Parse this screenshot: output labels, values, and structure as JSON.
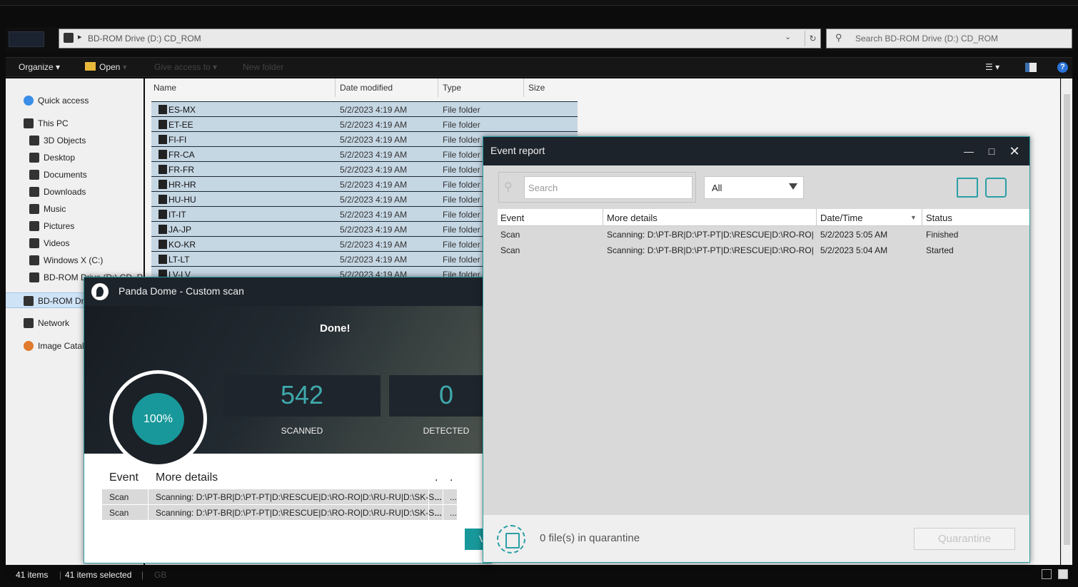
{
  "explorer": {
    "address": "BD-ROM Drive (D:) CD_ROM",
    "search_placeholder": "Search BD-ROM Drive (D:) CD_ROM",
    "toolbar": {
      "organize": "Organize",
      "open": "Open",
      "give_access": "Give access to",
      "new_folder": "New folder"
    },
    "nav": [
      {
        "label": "Quick access",
        "icon": "star-icon"
      },
      {
        "label": "This PC",
        "icon": "computer-icon"
      },
      {
        "label": "3D Objects",
        "icon": "folder-icon"
      },
      {
        "label": "Desktop",
        "icon": "folder-icon"
      },
      {
        "label": "Documents",
        "icon": "folder-icon"
      },
      {
        "label": "Downloads",
        "icon": "folder-icon"
      },
      {
        "label": "Music",
        "icon": "folder-icon"
      },
      {
        "label": "Pictures",
        "icon": "folder-icon"
      },
      {
        "label": "Videos",
        "icon": "folder-icon"
      },
      {
        "label": "Windows X (C:)",
        "icon": "drive-icon"
      },
      {
        "label": "BD-ROM Drive (D:) CD_RO",
        "icon": "disc-icon"
      },
      {
        "label": "BD-ROM Drive",
        "icon": "disc-icon"
      },
      {
        "label": "Network",
        "icon": "network-icon"
      },
      {
        "label": "Image Catal",
        "icon": "image-catalog-icon"
      }
    ],
    "columns": {
      "name": "Name",
      "date": "Date modified",
      "type": "Type",
      "size": "Size"
    },
    "files": [
      {
        "name": "ES-MX",
        "date": "5/2/2023 4:19 AM",
        "type": "File folder"
      },
      {
        "name": "ET-EE",
        "date": "5/2/2023 4:19 AM",
        "type": "File folder"
      },
      {
        "name": "FI-FI",
        "date": "5/2/2023 4:19 AM",
        "type": "File folder"
      },
      {
        "name": "FR-CA",
        "date": "5/2/2023 4:19 AM",
        "type": "File folder"
      },
      {
        "name": "FR-FR",
        "date": "5/2/2023 4:19 AM",
        "type": "File folder"
      },
      {
        "name": "HR-HR",
        "date": "5/2/2023 4:19 AM",
        "type": "File folder"
      },
      {
        "name": "HU-HU",
        "date": "5/2/2023 4:19 AM",
        "type": "File folder"
      },
      {
        "name": "IT-IT",
        "date": "5/2/2023 4:19 AM",
        "type": "File folder"
      },
      {
        "name": "JA-JP",
        "date": "5/2/2023 4:19 AM",
        "type": "File folder"
      },
      {
        "name": "KO-KR",
        "date": "5/2/2023 4:19 AM",
        "type": "File folder"
      },
      {
        "name": "LT-LT",
        "date": "5/2/2023 4:19 AM",
        "type": "File folder"
      },
      {
        "name": "LV-LV",
        "date": "5/2/2023 4:19 AM",
        "type": "File folder"
      }
    ],
    "status": {
      "items": "41 items",
      "selected": "41 items selected",
      "size": "GB"
    }
  },
  "panda": {
    "title": "Panda Dome - Custom scan",
    "done": "Done!",
    "progress_label": "100%",
    "scanned_value": "542",
    "scanned_label": "SCANNED",
    "detected_value": "0",
    "detected_label": "DETECTED",
    "table": {
      "col_event": "Event",
      "col_details": "More details",
      "col_dot1": ".",
      "col_dot2": ".",
      "rows": [
        {
          "event": "Scan",
          "details": "Scanning: D:\\PT-BR|D:\\PT-PT|D:\\RESCUE|D:\\RO-RO|D:\\RU-RU|D:\\SK-S...",
          "c3": "...",
          "c4": "..."
        },
        {
          "event": "Scan",
          "details": "Scanning: D:\\PT-BR|D:\\PT-PT|D:\\RESCUE|D:\\RO-RO|D:\\RU-RU|D:\\SK-S...",
          "c3": "...",
          "c4": "..."
        }
      ]
    },
    "button_partial": "V"
  },
  "event_report": {
    "title": "Event report",
    "search_placeholder": "Search",
    "filter_value": "All",
    "columns": {
      "event": "Event",
      "details": "More details",
      "datetime": "Date/Time",
      "status": "Status"
    },
    "rows": [
      {
        "event": "Scan",
        "details": "Scanning: D:\\PT-BR|D:\\PT-PT|D:\\RESCUE|D:\\RO-RO|D...",
        "datetime": "5/2/2023 5:05 AM",
        "status": "Finished"
      },
      {
        "event": "Scan",
        "details": "Scanning: D:\\PT-BR|D:\\PT-PT|D:\\RESCUE|D:\\RO-RO|D...",
        "datetime": "5/2/2023 5:04 AM",
        "status": "Started"
      }
    ],
    "quarantine_text": "0 file(s) in quarantine",
    "quarantine_button": "Quarantine"
  },
  "colors": {
    "accent": "#18989a",
    "title_dark": "#1d232b",
    "selection": "#c6d7e4"
  }
}
